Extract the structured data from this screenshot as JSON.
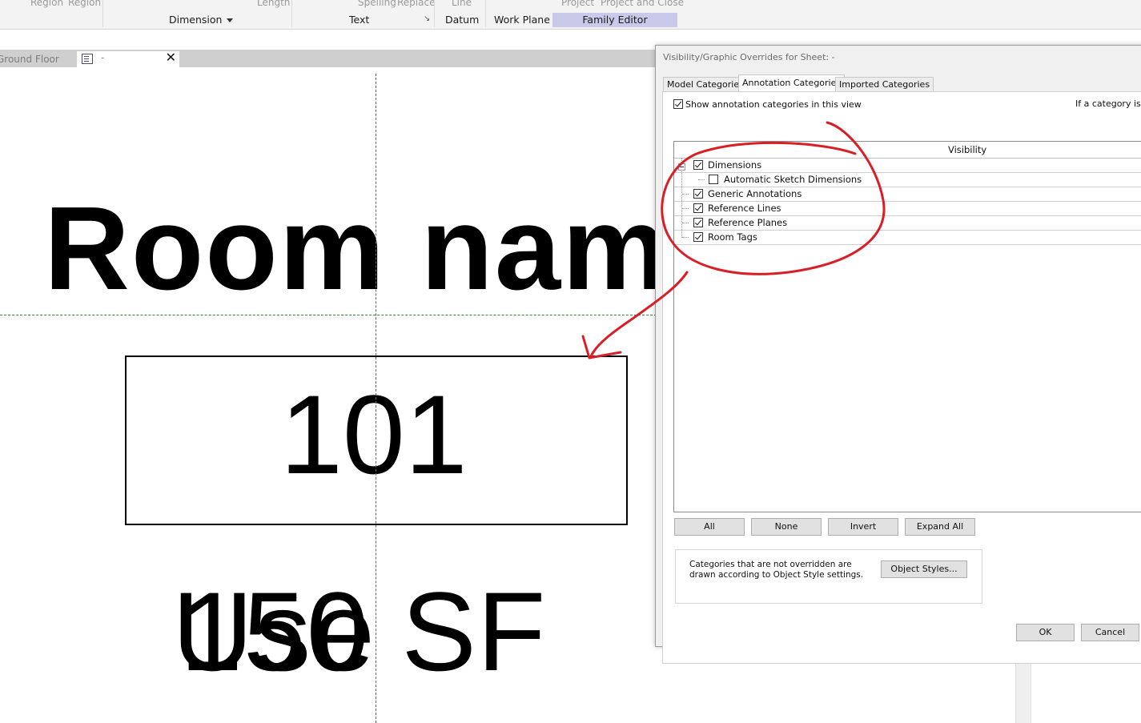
{
  "ribbon": {
    "top_labels": [
      "Region",
      "Region",
      "Length",
      "Spelling",
      "Replace",
      "Line",
      "Project",
      "Project and Close"
    ],
    "panels": {
      "dimension": "Dimension",
      "text": "Text",
      "datum": "Datum",
      "work_plane": "Work Plane",
      "family_editor": "Family Editor"
    }
  },
  "tabs": {
    "ground_floor": "Ground Floor",
    "sheet": "-"
  },
  "drawing": {
    "room_name": "Room name",
    "room_number": "101",
    "area": "150 SF",
    "use": "Use"
  },
  "dialog": {
    "title": "Visibility/Graphic Overrides for Sheet:  -",
    "tabs": [
      "Model Categories",
      "Annotation Categories",
      "Imported Categories"
    ],
    "active_tab": "Annotation Categories",
    "show_checkbox_label": "Show annotation categories in this view",
    "show_checked": true,
    "side_note": "If a category is u",
    "column_header": "Visibility",
    "categories": [
      {
        "label": "Dimensions",
        "checked": true
      },
      {
        "label": "Automatic Sketch Dimensions",
        "checked": false
      },
      {
        "label": "Generic Annotations",
        "checked": true
      },
      {
        "label": "Reference Lines",
        "checked": true
      },
      {
        "label": "Reference Planes",
        "checked": true
      },
      {
        "label": "Room Tags",
        "checked": true
      }
    ],
    "buttons": {
      "all": "All",
      "none": "None",
      "invert": "Invert",
      "expand_all": "Expand All"
    },
    "info_text": "Categories that are not overridden are drawn according to Object Style settings.",
    "object_styles": "Object Styles...",
    "ok": "OK",
    "cancel": "Cancel"
  },
  "annotation": {
    "color": "#d91f26"
  }
}
